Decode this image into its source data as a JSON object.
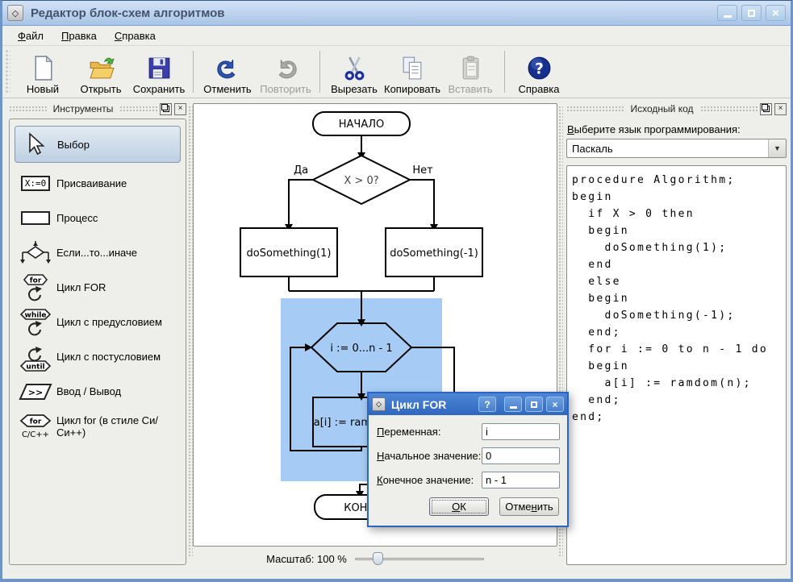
{
  "window": {
    "title": "Редактор блок-схем алгоритмов"
  },
  "menu": {
    "items": [
      {
        "pre": "",
        "accel": "Ф",
        "post": "айл"
      },
      {
        "pre": "",
        "accel": "П",
        "post": "равка"
      },
      {
        "pre": "",
        "accel": "С",
        "post": "правка"
      }
    ]
  },
  "toolbar": {
    "items": [
      {
        "label": "Новый"
      },
      {
        "label": "Открыть"
      },
      {
        "label": "Сохранить"
      },
      {
        "label": "Отменить"
      },
      {
        "label": "Повторить",
        "disabled": true
      },
      {
        "label": "Вырезать"
      },
      {
        "label": "Копировать"
      },
      {
        "label": "Вставить",
        "disabled": true
      },
      {
        "label": "Справка"
      }
    ]
  },
  "tools_panel": {
    "title": "Инструменты",
    "items": [
      {
        "label": "Выбор"
      },
      {
        "label": "Присваивание",
        "icon_text": "X:=0"
      },
      {
        "label": "Процесс"
      },
      {
        "label": "Если...то...иначе"
      },
      {
        "label": "Цикл FOR",
        "icon_text": "for"
      },
      {
        "label": "Цикл с предусловием",
        "icon_text": "while"
      },
      {
        "label": "Цикл с постусловием",
        "icon_text": "until"
      },
      {
        "label": "Ввод / Вывод",
        "icon_text": ">>"
      },
      {
        "label": "Цикл for (в стиле Си/Си++)",
        "icon_text": "for",
        "icon_sub": "C/C++"
      }
    ]
  },
  "canvas": {
    "flowchart": {
      "start": "НАЧАЛО",
      "condition": "X > 0?",
      "yes_label": "Да",
      "no_label": "Нет",
      "then_block": "doSomething(1)",
      "else_block": "doSomething(-1)",
      "loop_header": "i := 0...n - 1",
      "loop_body": "a[i] := ramdom(n)",
      "end": "КОНЕЦ",
      "highlight_color": "#a6ccf5"
    },
    "zoom_label": "Масштаб: 100 %"
  },
  "source_panel": {
    "title": "Исходный код",
    "language_label": {
      "pre": "",
      "accel": "В",
      "post": "ыберите язык программирования:"
    },
    "language_value": "Паскаль",
    "code_lines": [
      "procedure Algorithm;",
      "begin",
      "  if X > 0 then",
      "  begin",
      "    doSomething(1);",
      "  end",
      "  else",
      "  begin",
      "    doSomething(-1);",
      "  end;",
      "  for i := 0 to n - 1 do",
      "  begin",
      "    a[i] := ramdom(n);",
      "  end;",
      "end;"
    ]
  },
  "dialog": {
    "title": "Цикл FOR",
    "help_glyph": "?",
    "fields": [
      {
        "pre": "",
        "accel": "П",
        "post": "еременная:",
        "value": "i"
      },
      {
        "pre": "",
        "accel": "Н",
        "post": "ачальное значение:",
        "value": "0"
      },
      {
        "pre": "",
        "accel": "К",
        "post": "онечное значение:",
        "value": "n - 1"
      }
    ],
    "ok": {
      "pre": "",
      "accel": "О",
      "post": "К"
    },
    "cancel": {
      "pre": "Отме",
      "accel": "н",
      "post": "ить"
    }
  }
}
